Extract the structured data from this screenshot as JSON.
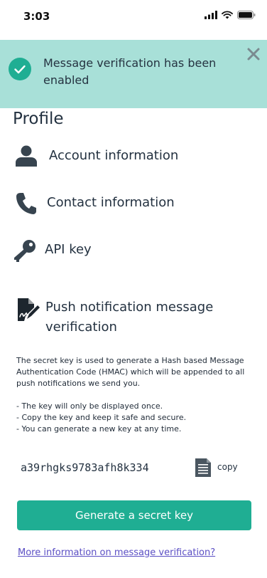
{
  "status_bar": {
    "time": "3:03"
  },
  "toast": {
    "message": "Message verification has been enabled"
  },
  "profile": {
    "title": "Profile"
  },
  "menu": {
    "account": "Account information",
    "contact": "Contact information",
    "api_key": "API key",
    "push": "Push notification message verification"
  },
  "description": {
    "intro": "The secret key is used to generate a Hash based Message Authentication Code (HMAC) which will be appended to all push notifications we send you.",
    "bullets": [
      "- The key will only be displayed once.",
      "- Copy the key and keep it safe and secure.",
      "- You can generate a new key at any time."
    ]
  },
  "secret": {
    "key": "a39rhgks9783afh8k334",
    "copy_label": "copy"
  },
  "actions": {
    "generate_label": "Generate a secret key",
    "more_info_link": "More information on message verification?"
  },
  "colors": {
    "toast_bg": "#a8e0d8",
    "accent": "#1fae93",
    "text": "#233140",
    "link": "#5b4fc4"
  },
  "icons": {
    "success": "check-circle-icon",
    "close": "close-icon",
    "account": "person-icon",
    "contact": "phone-icon",
    "api_key": "key-icon",
    "push": "document-signature-icon",
    "copy": "document-copy-icon"
  }
}
